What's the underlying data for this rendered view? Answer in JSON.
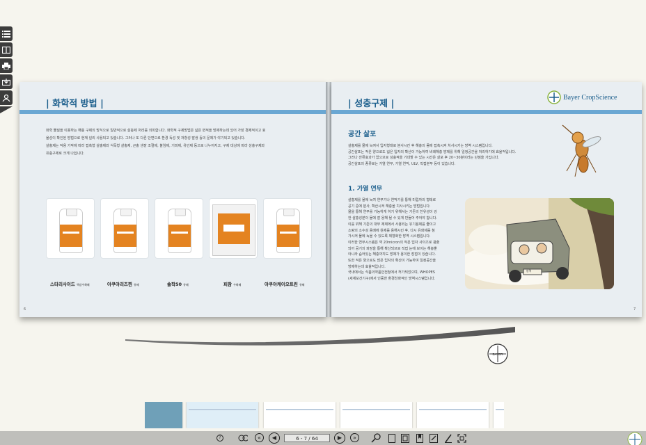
{
  "left_page": {
    "title": "| 화학적 방법 |",
    "intro": [
      "화학 물질을 이용하는 해충 구제의 방식으로 일반적으로 살충제 처리를 의미합니다. 화학적 구제방법은 넓은 면적을 방제하는데 있어 가장 경제적이고 효",
      "율성이 확인된 방법으로 현재 널리 사용되고 있습니다. 그러나 또 다른 단면으로 환경 독성 및 저항성 발생 등의 문제가 야기되고 있습니다.",
      "살충제는 작용 기작에 따라 접촉형 살충제와 식독형 살충제, 곤충 생장 조절제, 불임제, 기피제, 유인제 등으로 나누어지고, 구제 대상에 따라 성충구제와",
      "유충구제로 크게 나뉩니다."
    ],
    "products": [
      {
        "name": "스타리사이드",
        "sub": "액상수화제"
      },
      {
        "name": "아쿠아리즈찐",
        "sub": "유제"
      },
      {
        "name": "솔팍50",
        "sub": "유제"
      },
      {
        "name": "피참",
        "sub": "수화제"
      },
      {
        "name": "아쿠아케이오트린",
        "sub": "유제"
      }
    ],
    "page_number": "6"
  },
  "right_page": {
    "title": "| 성충구제 |",
    "brand": "Bayer CropScience",
    "section1_heading": "공간 살포",
    "section1_text": [
      "살충제를 물에 녹여서 입자형태로 분사시킨 후 해충의 몸에 접촉시켜 치사시키는 방역 시스템입니다.",
      "공간살포는 적은 양으로도 넓은 입자의 확산이 가능하여 비례해충 방제를 위해 일정공간을 처리하기에 효율적입니다.",
      "그러나 잔류효과가 없으므로 성충적을 기대할 수 있는 시간은 살포 후 20~30분이라는 단점을 가집니다.",
      "공간살포의 종류로는 가열 연무, 가열 연막, ULV, 직접분무 등이 있습니다."
    ],
    "section2_heading": "1. 가열 연무",
    "section2_text": [
      "살충제를 물에 녹여 연무기나 연막기를 통해 미립자의 형태로",
      "공기 중에 분사, 확산시켜 해충을 치사시키는 방법입니다.",
      "물을 통해 연무를 가능하게 하기 위해서는 기존의 친유성이 강",
      "한 살충성분이 물에 잘 용해 될 수 있게 만들어 주어야 합니다.",
      "이를 위해 기존의 대부 제제에서 사용되는 유기용제를 줄이고",
      "소량의 소수성 용매에 원제를 용해시킨 후, 다시 유화제를 첨",
      "가시켜 물에 녹을 수 있도록 제형화한 방역 시스템입니다.",
      "이러한 연무시스템은 약 20micron의 작은 입자 사이즈로 용출",
      "되어 공기의 파장을 통해 확산되므로 직접 눈에 보이는 해충뿐",
      "아니라 숨어있는 해충까지도 방제가 용이한 장점이 있습니다.",
      "또한 적은 양으로도 많은 입자의 확산이 가능하여 일정공간을",
      "방제하는데 효율적입니다.",
      "국내에서는 식품의약품안전청에서 허가되었으며, WHOPES",
      "(세계보건기구)에서 인증한 환경친화적인 방역시스템입니다."
    ],
    "illustration_label": "방역",
    "page_number": "7"
  },
  "footer_logo": "BAYER",
  "navigation": {
    "page_indicator": "6 - 7 / 64"
  },
  "toolbar_icons": [
    "list-icon",
    "book-icon",
    "print-icon",
    "download-icon",
    "user-icon"
  ],
  "colors": {
    "accent": "#1b5e8c",
    "bar": "#6aa7d3",
    "orange": "#e48320",
    "bayer_green": "#8ab33f"
  }
}
